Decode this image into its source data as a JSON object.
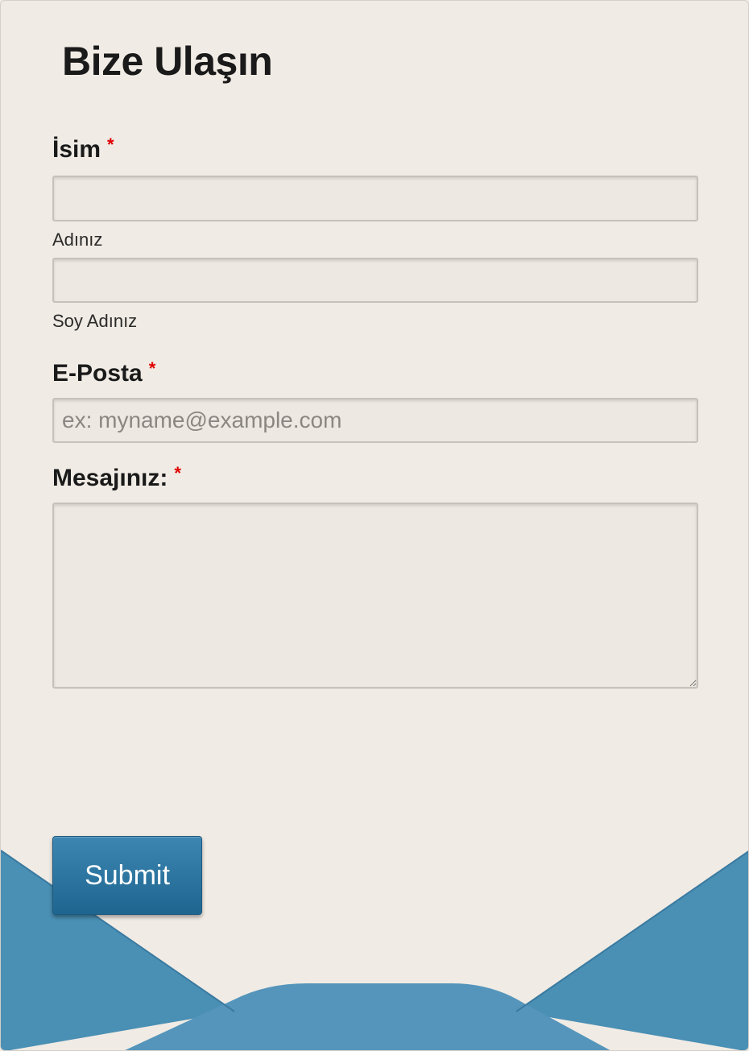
{
  "form": {
    "title": "Bize Ulaşın",
    "name": {
      "label": "İsim",
      "required_mark": "*",
      "first_value": "",
      "first_sublabel": "Adınız",
      "last_value": "",
      "last_sublabel": "Soy Adınız"
    },
    "email": {
      "label": "E-Posta",
      "required_mark": "*",
      "value": "",
      "placeholder": "ex: myname@example.com"
    },
    "message": {
      "label": "Mesajınız:",
      "required_mark": "*",
      "value": ""
    },
    "submit_label": "Submit"
  },
  "colors": {
    "background": "#f0ebe4",
    "envelope_blue": "#4a8fb4",
    "button": "#2a72a0",
    "required": "#e00000"
  }
}
